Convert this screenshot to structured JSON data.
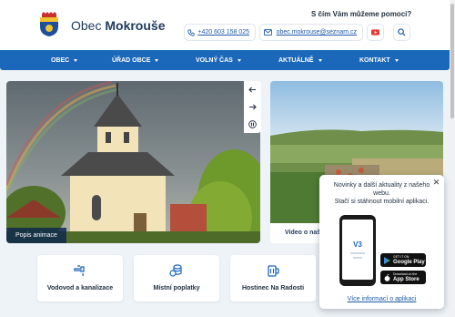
{
  "site": {
    "name_prefix": "Obec",
    "name_bold": "Mokrouše"
  },
  "header": {
    "help_text": "S čím Vám můžeme pomoci?",
    "phone": "+420 603 158 025",
    "email": "obec.mokrouse@seznam.cz",
    "icons": [
      "phone-icon",
      "mail-icon",
      "youtube-icon",
      "search-icon"
    ]
  },
  "nav": {
    "items": [
      {
        "label": "OBEC"
      },
      {
        "label": "ÚŘAD OBCE"
      },
      {
        "label": "VOLNÝ ČAS"
      },
      {
        "label": "AKTUÁLNĚ"
      },
      {
        "label": "KONTAKT"
      }
    ]
  },
  "hero": {
    "caption": "Popis animace",
    "controls": [
      "arrow-left-icon",
      "arrow-right-icon",
      "pause-icon"
    ]
  },
  "video": {
    "label": "Video o naší"
  },
  "popup": {
    "line1": "Novinky a další aktuality z našeho",
    "line2": "webu.",
    "line3": "Stačí si stáhnout mobilní aplikaci.",
    "google_small": "GET IT ON",
    "google_big": "Google Play",
    "apple_small": "Download on the",
    "apple_big": "App Store",
    "link": "Více informací o aplikaci"
  },
  "quick_links": [
    {
      "label": "Vodovod a kanalizace",
      "icon": "water-tap-icon"
    },
    {
      "label": "Místní poplatky",
      "icon": "coins-icon"
    },
    {
      "label": "Hostinec Na Radosti",
      "icon": "beer-mug-icon"
    }
  ],
  "colors": {
    "primary": "#1b67b9",
    "accent_red": "#e53935",
    "background": "#eef3f8"
  }
}
